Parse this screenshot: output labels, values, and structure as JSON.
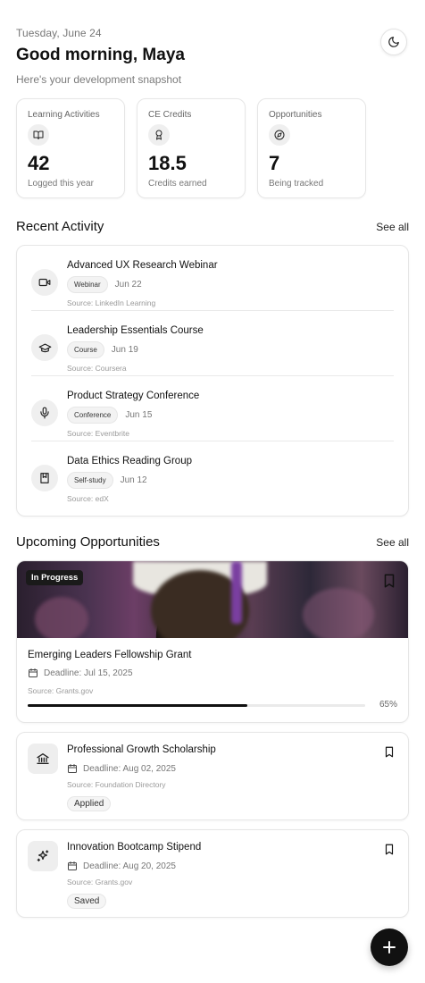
{
  "header": {
    "date": "Tuesday, June 24",
    "greeting": "Good morning, Maya",
    "subtitle": "Here's your development snapshot",
    "theme_icon": "moon-icon"
  },
  "stats": [
    {
      "label": "Learning Activities",
      "icon": "book-open-icon",
      "value": "42",
      "caption": "Logged this year"
    },
    {
      "label": "CE Credits",
      "icon": "award-icon",
      "value": "18.5",
      "caption": "Credits earned"
    },
    {
      "label": "Opportunities",
      "icon": "compass-icon",
      "value": "7",
      "caption": "Being tracked"
    }
  ],
  "recent": {
    "title": "Recent Activity",
    "see_all": "See all",
    "items": [
      {
        "title": "Advanced UX Research Webinar",
        "tag": "Webinar",
        "date": "Jun 22",
        "source": "Source: LinkedIn Learning",
        "icon": "video-icon"
      },
      {
        "title": "Leadership Essentials Course",
        "tag": "Course",
        "date": "Jun 19",
        "source": "Source: Coursera",
        "icon": "graduation-cap-icon"
      },
      {
        "title": "Product Strategy Conference",
        "tag": "Conference",
        "date": "Jun 15",
        "source": "Source: Eventbrite",
        "icon": "microphone-icon"
      },
      {
        "title": "Data Ethics Reading Group",
        "tag": "Self-study",
        "date": "Jun 12",
        "source": "Source: edX",
        "icon": "book-icon"
      }
    ]
  },
  "upcoming": {
    "title": "Upcoming Opportunities",
    "see_all": "See all",
    "featured": {
      "badge": "In Progress",
      "title": "Emerging Leaders Fellowship Grant",
      "deadline": "Deadline: Jul 15, 2025",
      "source": "Source: Grants.gov",
      "progress": 0.65,
      "progress_label": "65%"
    },
    "items": [
      {
        "title": "Professional Growth Scholarship",
        "deadline": "Deadline: Aug 02, 2025",
        "source": "Source: Foundation Directory",
        "status": "Applied",
        "icon": "bank-icon"
      },
      {
        "title": "Innovation Bootcamp Stipend",
        "deadline": "Deadline: Aug 20, 2025",
        "source": "Source: Grants.gov",
        "status": "Saved",
        "icon": "sparkles-icon"
      }
    ]
  },
  "fab": {
    "icon": "plus-icon"
  }
}
